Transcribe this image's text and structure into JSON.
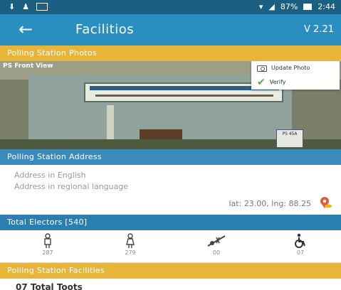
{
  "status_bar": {
    "icons": [
      "download-icon",
      "notification-icon",
      "sim-icon",
      "wifi-icon",
      "signal-icon",
      "battery-icon"
    ],
    "battery": "87%",
    "time": "2:44"
  },
  "app_bar": {
    "title": "Facilitios",
    "version": "V 2.21"
  },
  "photos": {
    "header": "Polling Station Photos",
    "photo_label": "PS Front View",
    "menu": {
      "update_label": "Update Photo",
      "verify_label": "Verify"
    },
    "sign_text": "PS 45A"
  },
  "address": {
    "header": "Polling Station Address",
    "english_placeholder": "Address in English",
    "regional_placeholder": "Address in regional language",
    "latlng": "lat: 23.00, lng: 88.25"
  },
  "electors": {
    "header": "Total Electors [540]",
    "groups": [
      {
        "icon": "male-icon",
        "count": "287"
      },
      {
        "icon": "female-icon",
        "count": "279"
      },
      {
        "icon": "third-gender-icon",
        "count": "00"
      },
      {
        "icon": "disabled-icon",
        "count": "07"
      }
    ]
  },
  "facilities": {
    "header": "Polling Station Facilities",
    "first_item": "07 Total Toots"
  },
  "colors": {
    "status_bar": "#1b5f82",
    "app_bar": "#2b8ec0",
    "section_gold": "#e8b53b",
    "section_blue": "#2a7fb0",
    "pin_red": "#e05a3a",
    "pin_gold": "#f0b400"
  }
}
